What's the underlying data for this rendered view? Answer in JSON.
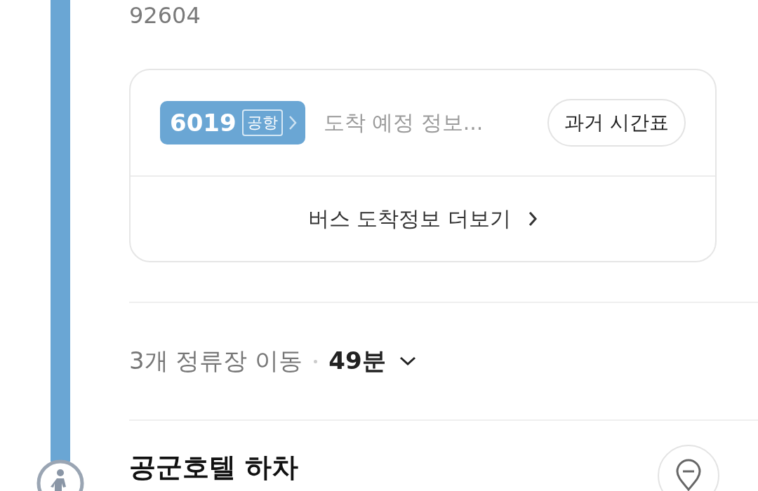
{
  "stop_number": "92604",
  "bus_card": {
    "route_number": "6019",
    "route_tag": "공항",
    "arrival_info": "도착 예정 정보...",
    "timetable_button": "과거 시간표",
    "more_link": "버스 도착정보 더보기"
  },
  "ride_summary": {
    "stops": "3개 정류장 이동",
    "duration": "49분",
    "expanded": false
  },
  "next_step": {
    "title": "공군호텔 하차"
  }
}
